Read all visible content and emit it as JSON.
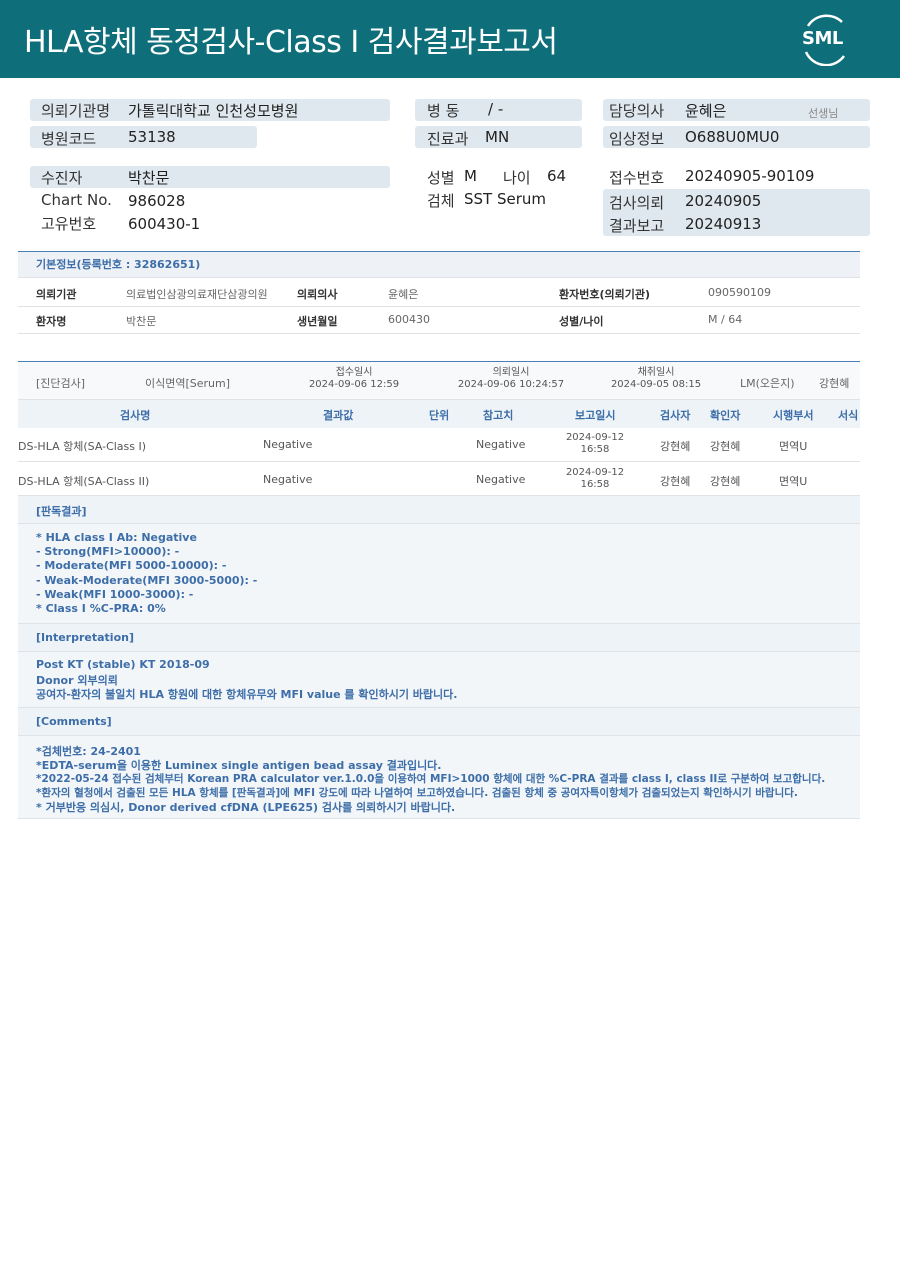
{
  "header": {
    "title": "HLA항체  동정검사-Class I 검사결과보고서",
    "logo_text": "SML"
  },
  "patient_info": {
    "inst_label": "의뢰기관명",
    "inst_value": "가톨릭대학교 인천성모병원",
    "code_label": "병원코드",
    "code_value": "53138",
    "ward_label": "병  동",
    "ward_value": "/ -",
    "dept_label": "진료과",
    "dept_value": "MN",
    "doctor_label": "담당의사",
    "doctor_value": "윤혜은",
    "doctor_suffix": "선생님",
    "clinical_label": "임상정보",
    "clinical_value": "O688U0MU0",
    "patient_label": "수진자",
    "patient_value": "박찬문",
    "chart_label": "Chart No.",
    "chart_value": "986028",
    "uid_label": "고유번호",
    "uid_value": "600430-1",
    "sex_label": "성별",
    "sex_value": "M",
    "age_label": "나이",
    "age_value": "64",
    "spec_label": "검체",
    "spec_value": "SST Serum",
    "recv_label": "접수번호",
    "recv_value": "20240905-90109",
    "req_label": "검사의뢰",
    "req_value": "20240905",
    "rep_label": "결과보고",
    "rep_value": "20240913"
  },
  "basic": {
    "head": "기본정보(등록번호 : 32862651)",
    "r1": {
      "l1": "의뢰기관",
      "v1": "의료법인삼광의료재단삼광의원",
      "l2": "의뢰의사",
      "v2": "윤혜은",
      "l3": "환자번호(의뢰기관)",
      "v3": "090590109"
    },
    "r2": {
      "l1": "환자명",
      "v1": "박찬문",
      "l2": "생년월일",
      "v2": "600430",
      "l3": "성별/나이",
      "v3": "M / 64"
    }
  },
  "dx": {
    "c1": "[진단검사]",
    "c2": "이식면역[Serum]",
    "recv_label": "접수일시",
    "recv_value": "2024-09-06 12:59",
    "req_label": "의뢰일시",
    "req_value": "2024-09-06 10:24:57",
    "col_label": "채취일시",
    "col_value": "2024-09-05 08:15",
    "c6": "LM(오은지)",
    "c7": "강현혜"
  },
  "table": {
    "headers": [
      "검사명",
      "결과값",
      "단위",
      "참고치",
      "보고일시",
      "검사자",
      "확인자",
      "시행부서",
      "서식"
    ],
    "rows": [
      {
        "name": "DS-HLA 항체(SA-Class I)",
        "result": "Negative",
        "ref": "Negative",
        "date": "2024-09-12",
        "time": "16:58",
        "tester": "강현혜",
        "checker": "강현혜",
        "dept": "면역U"
      },
      {
        "name": "DS-HLA 항체(SA-Class II)",
        "result": "Negative",
        "ref": "Negative",
        "date": "2024-09-12",
        "time": "16:58",
        "tester": "강현혜",
        "checker": "강현혜",
        "dept": "면역U"
      }
    ]
  },
  "judgement": {
    "head": "[판독결과]",
    "lines": [
      "* HLA class I Ab: Negative",
      "- Strong(MFI>10000): -",
      "- Moderate(MFI 5000-10000): -",
      "- Weak-Moderate(MFI 3000-5000): -",
      "- Weak(MFI 1000-3000): -",
      "* Class I %C-PRA: 0%"
    ]
  },
  "interpretation": {
    "head": "[Interpretation]",
    "lines": [
      "Post KT (stable) KT 2018-09",
      "Donor 외부의뢰",
      "공여자-환자의 불일치 HLA 항원에 대한 항체유무와 MFI value 를 확인하시기 바랍니다."
    ]
  },
  "comments": {
    "head": "[Comments]",
    "lines": [
      "*검체번호: 24-2401",
      "*EDTA-serum을 이용한 Luminex single antigen bead assay 결과입니다.",
      "*2022-05-24 접수된 검체부터 Korean PRA calculator ver.1.0.0을 이용하여 MFI>1000 항체에 대한 %C-PRA 결과를 class I, class II로 구분하여 보고합니다.",
      "*환자의 혈청에서 검출된 모든 HLA 항체를 [판독결과]에 MFI 강도에 따라 나열하여 보고하였습니다. 검출된 항체 중 공여자특이항체가 검출되었는지 확인하시기 바랍니다.",
      "* 거부반응 의심시, Donor derived cfDNA (LPE625) 검사를 의뢰하시기 바랍니다."
    ]
  }
}
